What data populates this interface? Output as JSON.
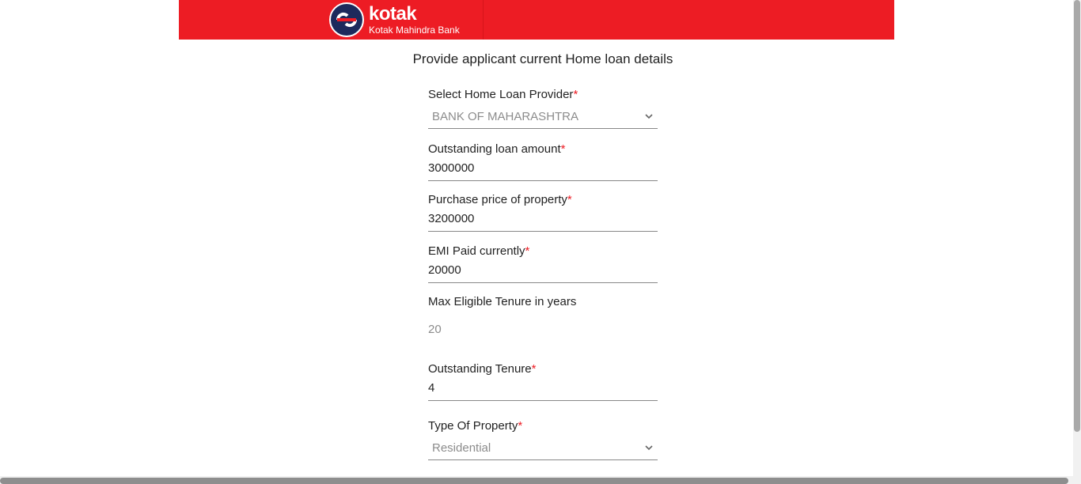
{
  "brand": {
    "name": "kotak",
    "subtitle": "Kotak Mahindra Bank"
  },
  "page": {
    "title": "Provide applicant current Home loan details"
  },
  "form": {
    "provider": {
      "label": "Select Home Loan Provider",
      "value": "BANK OF MAHARASHTRA",
      "required": "*"
    },
    "outstanding_amount": {
      "label": "Outstanding loan amount",
      "value": "3000000",
      "required": "*"
    },
    "purchase_price": {
      "label": "Purchase price of property",
      "value": "3200000",
      "required": "*"
    },
    "emi": {
      "label": "EMI Paid currently",
      "value": "20000",
      "required": "*"
    },
    "max_tenure": {
      "label": "Max Eligible Tenure in years",
      "value": "20"
    },
    "outstanding_tenure": {
      "label": "Outstanding Tenure",
      "value": "4",
      "required": "*"
    },
    "property_type": {
      "label": "Type Of Property",
      "value": "Residential",
      "required": "*"
    }
  },
  "colors": {
    "brand_red": "#ed1c24",
    "logo_navy": "#1d2a5c"
  },
  "icons": {
    "dropdown": "chevron-down-icon"
  }
}
